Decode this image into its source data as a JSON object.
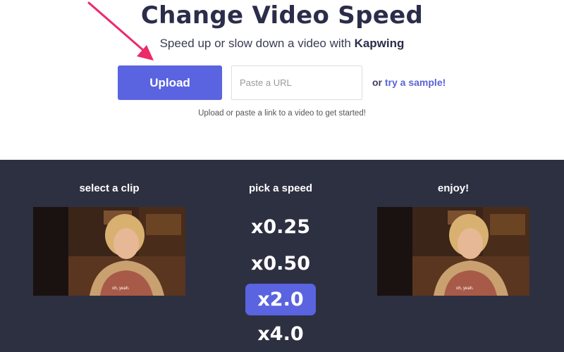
{
  "header": {
    "title": "Change Video Speed",
    "subtitle_prefix": "Speed up or slow down a video with",
    "subtitle_brand": "Kapwing"
  },
  "upload": {
    "button_label": "Upload",
    "url_placeholder": "Paste a URL",
    "or_text": "or",
    "sample_link": "try a sample!",
    "hint": "Upload or paste a link to a video to get started!"
  },
  "steps": {
    "select_label": "select a clip",
    "pick_label": "pick a speed",
    "enjoy_label": "enjoy!",
    "subtitle_caption": "oh, yeah."
  },
  "speeds": [
    {
      "label": "x0.25",
      "active": false
    },
    {
      "label": "x0.50",
      "active": false
    },
    {
      "label": "x2.0",
      "active": true
    },
    {
      "label": "x4.0",
      "active": false
    }
  ],
  "colors": {
    "accent": "#5a63e0",
    "dark_band": "#2d3041",
    "title": "#2b2d4a",
    "arrow": "#ec2a68"
  },
  "icons": {
    "arrow": "pointer-arrow-icon"
  }
}
